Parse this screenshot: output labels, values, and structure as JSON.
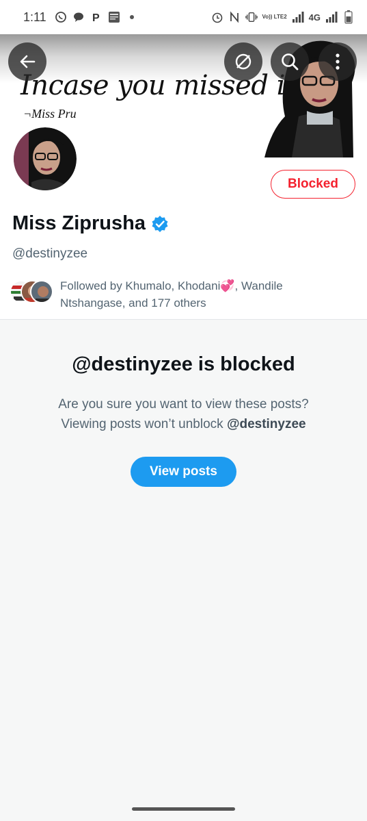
{
  "status_bar": {
    "time": "1:11",
    "network": "4G",
    "lte_label": "Vo)) LTE2",
    "icons": [
      "whatsapp-icon",
      "chat-icon",
      "pinterest-icon",
      "news-icon",
      "dot-icon",
      "alarm-icon",
      "nfc-icon",
      "vibrate-icon",
      "signal-icon",
      "battery-icon"
    ]
  },
  "banner": {
    "headline": "Incase you missed it...",
    "signature": "¬Miss Pru"
  },
  "nav": {
    "back_icon": "arrow-left-icon",
    "hide_icon": "eye-slash-icon",
    "search_icon": "search-icon",
    "more_icon": "more-vertical-icon"
  },
  "profile": {
    "blocked_label": "Blocked",
    "display_name": "Miss Ziprusha",
    "handle": "@destinyzee",
    "followed_by": "Followed by Khumalo, Khodani💞, Wandile Ntshangase, and 177 others"
  },
  "blocked_notice": {
    "title": "@destinyzee is blocked",
    "line1": "Are you sure you want to view these posts?",
    "line2_prefix": "Viewing posts won’t unblock ",
    "line2_handle": "@destinyzee",
    "button_label": "View posts"
  },
  "colors": {
    "accent": "#1d9bf0",
    "blocked_red": "#f4212e",
    "muted_text": "#536471",
    "background": "#f6f7f7"
  }
}
